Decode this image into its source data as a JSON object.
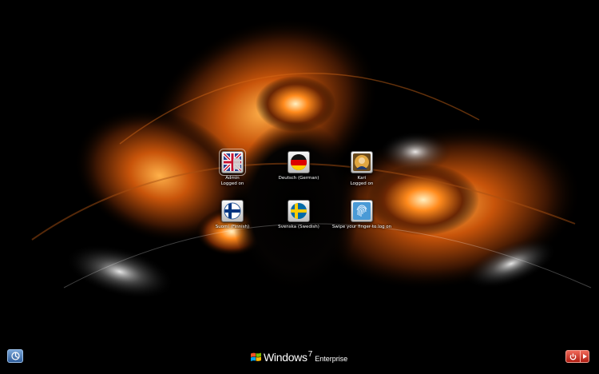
{
  "accounts": [
    {
      "name": "Admin",
      "status": "Logged on",
      "icon": "uk-flag-icon"
    },
    {
      "name": "Deutsch (German)",
      "status": "",
      "icon": "germany-flag-icon"
    },
    {
      "name": "Kari",
      "status": "Logged on",
      "icon": "user-photo-icon"
    },
    {
      "name": "Suomi (Finnish)",
      "status": "",
      "icon": "finland-flag-icon"
    },
    {
      "name": "Svenska (Swedish)",
      "status": "",
      "icon": "sweden-flag-icon"
    },
    {
      "name": "Swipe your finger to log on",
      "status": "",
      "icon": "fingerprint-icon"
    }
  ],
  "branding": {
    "product": "Windows",
    "version": "7",
    "edition": "Enterprise"
  },
  "buttons": {
    "ease_of_access": "ease-of-access-icon",
    "shutdown": "power-icon",
    "shutdown_options": "arrow-right-icon"
  },
  "colors": {
    "accent": "#e8730c",
    "power": "#c8281a",
    "text": "#ffffff"
  }
}
